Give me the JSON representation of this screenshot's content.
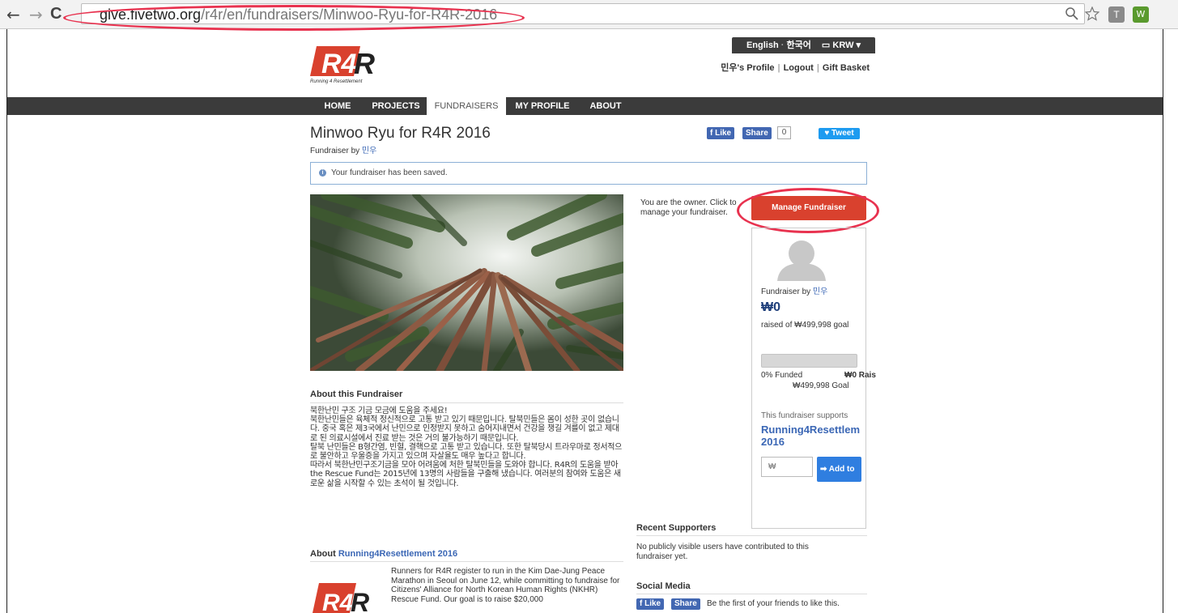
{
  "browser": {
    "back_icon": "←",
    "forward_icon": "→",
    "reload_icon": "C",
    "url_host": "give.fivetwo.org",
    "url_path": "/r4r/en/fundraisers/Minwoo-Ryu-for-R4R-2016",
    "zoom_icon": "zoom-icon",
    "star_icon": "star-icon",
    "ext1_label": "T",
    "ext2_label": "W"
  },
  "header": {
    "logo_text": "R4R",
    "logo_tagline": "Running 4 Resettlement",
    "lang_en": "English",
    "lang_ko": "한국어",
    "currency": "KRW",
    "profile_link": "민우's Profile",
    "logout_link": "Logout",
    "basket_link": "Gift Basket"
  },
  "nav": {
    "items": [
      {
        "label": "HOME"
      },
      {
        "label": "PROJECTS"
      },
      {
        "label": "FUNDRAISERS"
      },
      {
        "label": "MY PROFILE"
      },
      {
        "label": "ABOUT"
      }
    ]
  },
  "fundraiser": {
    "title": "Minwoo Ryu for R4R 2016",
    "byline_prefix": "Fundraiser by",
    "owner_name": "민우",
    "fb_like": "Like",
    "fb_share": "Share",
    "fb_count": "0",
    "tweet": "Tweet",
    "notice": "Your fundraiser has been saved.",
    "owner_text": "You are the owner. Click to manage your fundraiser.",
    "manage_button": "Manage Fundraiser"
  },
  "sidebar": {
    "by_prefix": "Fundraiser by",
    "owner_name": "민우",
    "amount": "₩0",
    "raised_text": "raised of ₩499,998 goal",
    "progress_pct": 0,
    "funded_text": "0% Funded",
    "raised_label": "₩0 Rais",
    "goal_text": "₩499,998 Goal",
    "supports_text": "This fundraiser supports",
    "campaign_name": "Running4Resettlem 2016",
    "amount_placeholder": "₩",
    "add_button": "Add to"
  },
  "about": {
    "heading": "About this Fundraiser",
    "body": "북한난민 구조 기금 모금에 도움을 주세요!\n북한난민들은 육체적 정신적으로 고통 받고 있기 때문입니다. 탈북민들은 몸이 성한 곳이 없습니다. 중국 혹은 제3국에서 난민으로 인정받지 못하고 숨어지내면서 건강을 챙길 겨를이 없고 제대로 된 의료시설에서 진료 받는 것은 거의 불가능하기 때문입니다.\n탈북 난민들은 B형간염, 빈혈, 결핵으로 고통 받고 있습니다. 또한 탈북당시 트라우마로 정서적으로 불안하고 우울증을 가지고 있으며 자살율도 매우 높다고 합니다.\n따라서 북한난민구조기금을 모아 어려움에 처한 탈북민들을 도와야 합니다. R4R의 도움을 받아 the Rescue Fund는 2015년에 13명의 사람들을 구출해 냈습니다. 여러분의 참여와 도움은 새로운 삶을 시작할 수 있는 초석이 될 것입니다."
  },
  "campaign": {
    "heading_prefix": "About",
    "heading_link": "Running4Resettlement 2016",
    "description": "Runners for R4R register to run in the Kim Dae-Jung Peace Marathon in Seoul on June 12, while committing to fundraise for Citizens' Alliance for North Korean Human Rights (NKHR) Rescue Fund. Our goal is to raise $20,000"
  },
  "recent": {
    "heading": "Recent Supporters",
    "text": "No publicly visible users have contributed to this fundraiser yet."
  },
  "social": {
    "heading": "Social Media",
    "like": "Like",
    "share": "Share",
    "text": "Be the first of your friends to like this."
  },
  "colors": {
    "brand_red": "#d9412e",
    "link_blue": "#3b67b5",
    "nav_dark": "#3b3b3b",
    "annotation_red": "#e8324f"
  }
}
